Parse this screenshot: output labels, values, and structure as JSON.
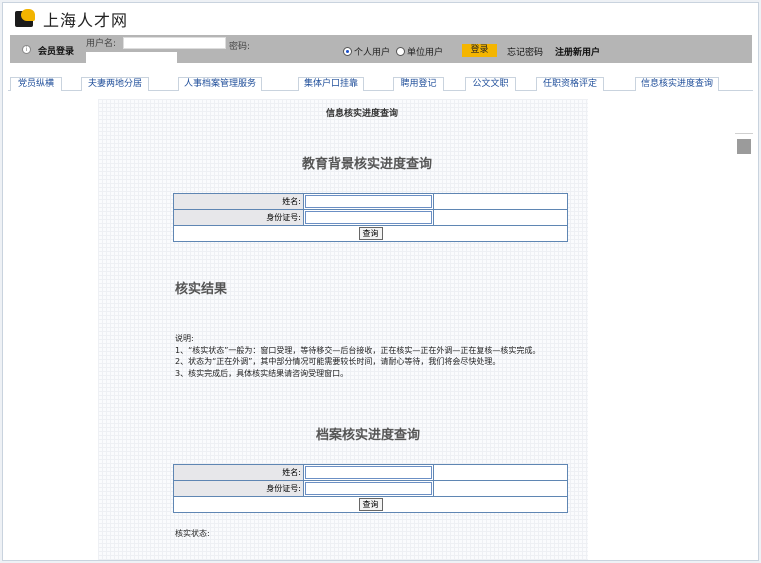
{
  "site": {
    "title": "上海人才网"
  },
  "login": {
    "member_label": "会员登录",
    "username_label": "用户名:",
    "password_label": "密码:",
    "radio_personal": "个人用户",
    "radio_company": "单位用户",
    "selected": "个人用户",
    "login_button": "登录",
    "forgot_password": "忘记密码",
    "register": "注册新用户"
  },
  "nav": {
    "tabs": [
      "党员纵横",
      "夫妻两地分居",
      "人事档案管理服务",
      "集体户口挂靠",
      "聘用登记",
      "公文文职",
      "任职资格评定",
      "信息核实进度查询"
    ]
  },
  "page": {
    "title": "信息核实进度查询"
  },
  "education": {
    "title": "教育背景核实进度查询",
    "name_label": "姓名:",
    "id_label": "身份证号:",
    "query_button": "查询"
  },
  "result": {
    "title": "核实结果",
    "notes": [
      "说明:",
      "1、“核实状态”一般为：窗口受理，等待移交—后台接收，正在核实—正在外调—正在复核—核实完成。",
      "2、状态为“正在外调”，其中部分情况可能需要较长时间，请耐心等待，我们将会尽快处理。",
      "3、核实完成后，具体核实结果请咨询受理窗口。"
    ]
  },
  "archive": {
    "title": "档案核实进度查询",
    "name_label": "姓名:",
    "id_label": "身份证号:",
    "query_button": "查询",
    "status_label": "核实状态:"
  }
}
